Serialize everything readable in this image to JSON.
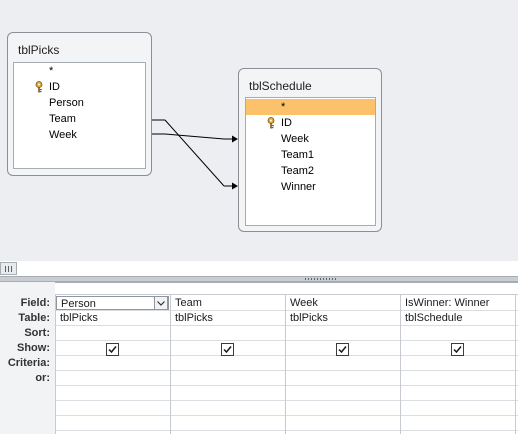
{
  "tables": {
    "tblPicks": {
      "title": "tblPicks",
      "fields": [
        "*",
        "ID",
        "Person",
        "Team",
        "Week"
      ]
    },
    "tblSchedule": {
      "title": "tblSchedule",
      "fields": [
        "*",
        "ID",
        "Week",
        "Team1",
        "Team2",
        "Winner"
      ]
    }
  },
  "grid": {
    "row_labels": {
      "field": "Field:",
      "table": "Table:",
      "sort": "Sort:",
      "show": "Show:",
      "criteria": "Criteria:",
      "or": "or:"
    },
    "columns": [
      {
        "field": "Person",
        "table": "tblPicks",
        "show": true
      },
      {
        "field": "Team",
        "table": "tblPicks",
        "show": true
      },
      {
        "field": "Week",
        "table": "tblPicks",
        "show": true
      },
      {
        "field": "IsWinner: Winner",
        "table": "tblSchedule",
        "show": true
      }
    ]
  },
  "colors": {
    "selected_field": "#fbc16b",
    "design_background": "#eceef1"
  },
  "icons": {
    "primary_key": "key-icon",
    "dropdown": "chevron-down-icon",
    "checkbox": "checkmark-icon",
    "splitter": "grip-icon"
  }
}
